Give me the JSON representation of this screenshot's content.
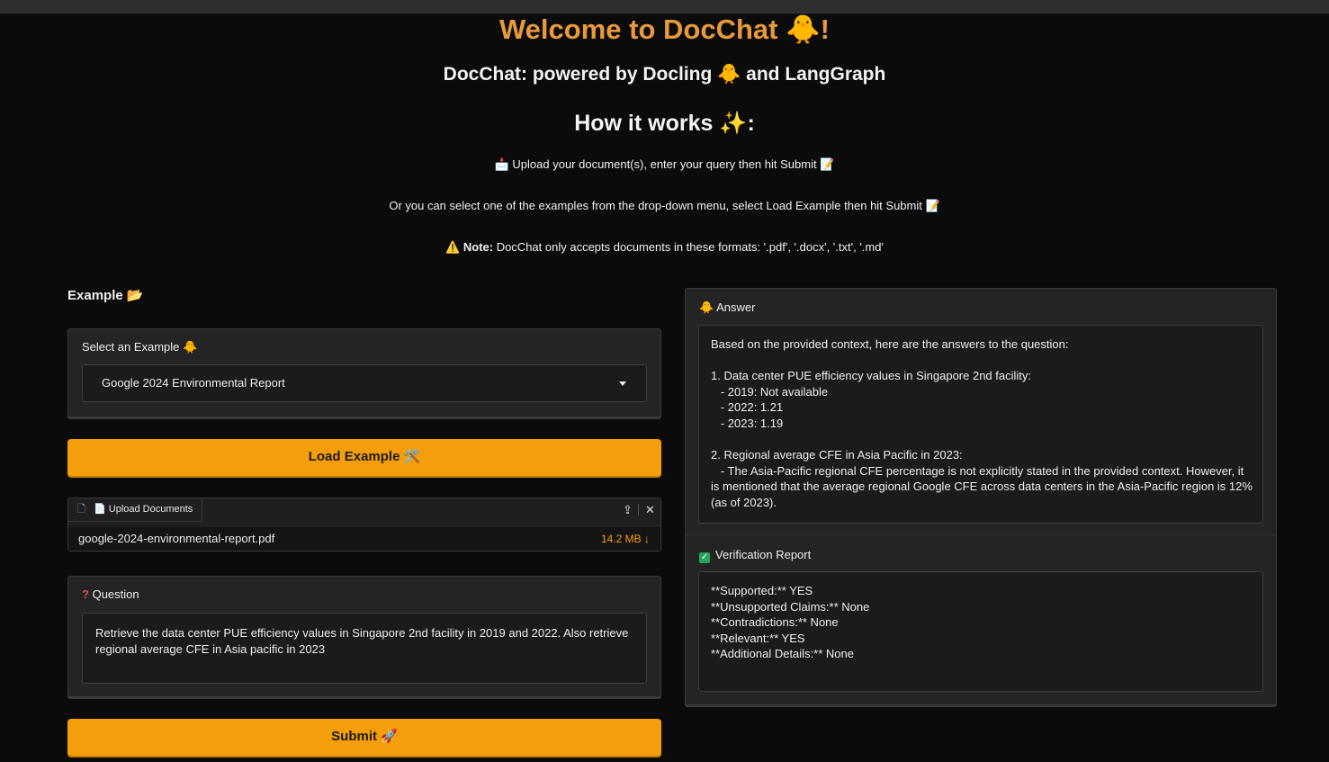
{
  "header": {
    "title": "Welcome to DocChat 🐥!",
    "subtitle": "DocChat: powered by Docling 🐥 and LangGraph",
    "how_it_works": "How it works ✨:",
    "info1": "📩 Upload your document(s), enter your query then hit Submit 📝",
    "info2": "Or you can select one of the examples from the drop-down menu, select Load Example then hit Submit 📝",
    "note_icon": "⚠️",
    "note_bold": "Note:",
    "note_text": " DocChat only accepts documents in these formats: '.pdf', '.docx', '.txt', '.md'"
  },
  "example": {
    "heading": "Example 📂",
    "select_label": "Select an Example 🐥",
    "selected_value": "Google 2024 Environmental Report",
    "load_button": "Load Example 🛠️"
  },
  "upload": {
    "tab_label": "📄 Upload Documents",
    "file_name": "google-2024-environmental-report.pdf",
    "file_size": "14.2 MB ↓"
  },
  "question": {
    "label": "Question",
    "text": "Retrieve the data center PUE efficiency values in Singapore 2nd facility in 2019 and 2022. Also retrieve regional average CFE in Asia pacific in 2023"
  },
  "submit_button": "Submit 🚀",
  "answer": {
    "label": "🐥 Answer",
    "lines": [
      "Based on the provided context, here are the answers to the question:",
      "",
      "1. Data center PUE efficiency values in Singapore 2nd facility:",
      "   - 2019: Not available",
      "   - 2022: 1.21",
      "   - 2023: 1.19",
      "",
      "2. Regional average CFE in Asia Pacific in 2023:",
      "   - The Asia-Pacific regional CFE percentage is not explicitly stated in the provided context. However, it",
      "is mentioned that the average regional Google CFE across data centers in the Asia-Pacific region is 12%",
      "(as of 2023)."
    ]
  },
  "verification": {
    "label": "Verification Report",
    "lines": [
      "**Supported:** YES",
      "**Unsupported Claims:** None",
      "**Contradictions:** None",
      "**Relevant:** YES",
      "**Additional Details:** None"
    ]
  }
}
